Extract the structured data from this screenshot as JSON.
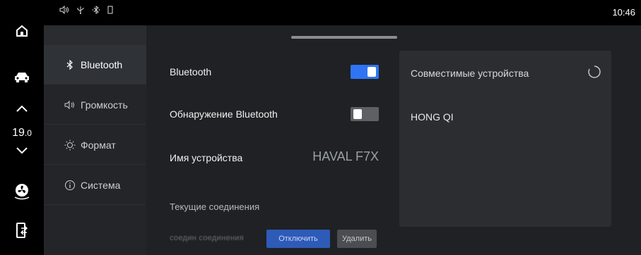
{
  "status_bar": {
    "icons": [
      "volume-icon",
      "usb-icon",
      "bluetooth-icon",
      "battery-icon"
    ],
    "time": "10:46"
  },
  "rail": {
    "temperature_main": "19",
    "temperature_decimal": ".0"
  },
  "nav": {
    "items": [
      {
        "label": "Bluetooth",
        "icon": "bluetooth-icon",
        "active": true
      },
      {
        "label": "Громкость",
        "icon": "volume-icon",
        "active": false
      },
      {
        "label": "Формат",
        "icon": "sun-icon",
        "active": false
      },
      {
        "label": "Система",
        "icon": "info-icon",
        "active": false
      }
    ]
  },
  "settings": {
    "bluetooth_label": "Bluetooth",
    "bluetooth_on": true,
    "discovery_label": "Обнаружение Bluetooth",
    "discovery_on": false,
    "device_name_label": "Имя устройства",
    "device_name_value": "HAVAL F7X",
    "current_connections_title": "Текущие соединения",
    "connection_name": "соедин соединения",
    "disconnect_label": "Отключить",
    "delete_label": "Удалить"
  },
  "devices": {
    "title": "Совместимые устройства",
    "items": [
      "HONG QI"
    ]
  },
  "colors": {
    "accent": "#2f74f5",
    "panel_bg": "#1f2124",
    "card_bg": "#2b2d31"
  }
}
